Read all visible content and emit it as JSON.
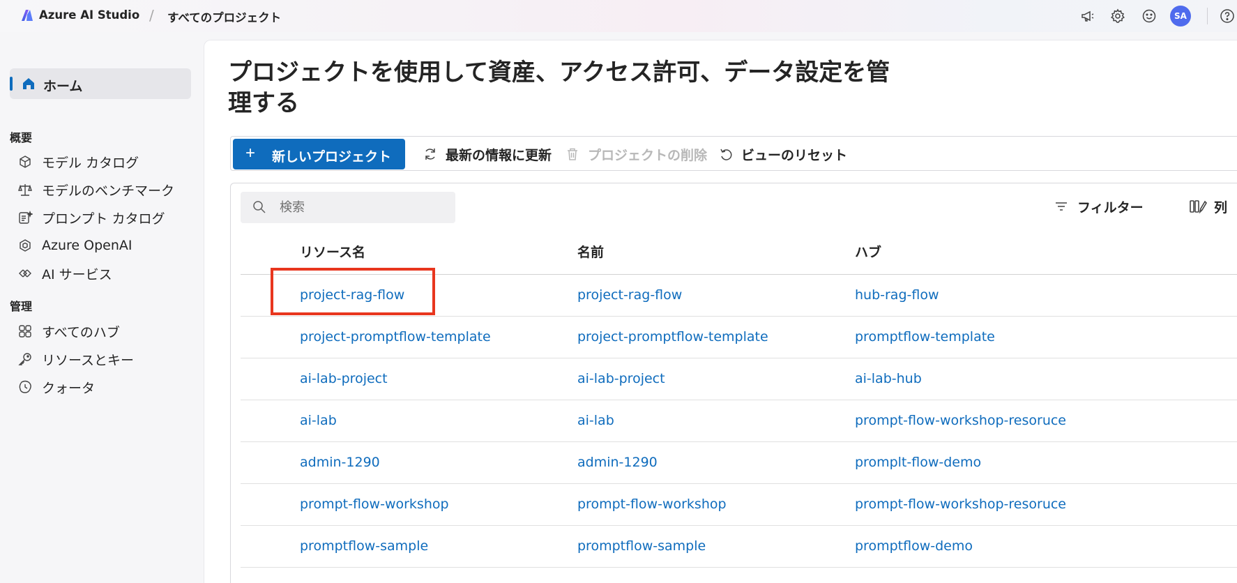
{
  "app": {
    "title": "Azure AI Studio",
    "breadcrumb_separator": "/",
    "breadcrumb": "すべてのプロジェクト",
    "avatar_initials": "SA",
    "brand_color": "#0f6cbd",
    "top_icons": [
      "announcement-icon",
      "settings-gear-icon",
      "feedback-smiley-icon",
      "help-icon"
    ]
  },
  "sidebar": {
    "home_label": "ホーム",
    "sections": [
      {
        "title": "概要",
        "items": [
          {
            "label": "モデル カタログ",
            "icon": "cube-icon"
          },
          {
            "label": "モデルのベンチマーク",
            "icon": "scale-icon"
          },
          {
            "label": "プロンプト カタログ",
            "icon": "prompt-icon"
          },
          {
            "label": "Azure OpenAI",
            "icon": "openai-icon"
          },
          {
            "label": "AI サービス",
            "icon": "ai-services-icon"
          }
        ]
      },
      {
        "title": "管理",
        "items": [
          {
            "label": "すべてのハブ",
            "icon": "grid-icon"
          },
          {
            "label": "リソースとキー",
            "icon": "key-icon"
          },
          {
            "label": "クォータ",
            "icon": "quota-icon"
          }
        ]
      }
    ]
  },
  "main": {
    "title": "プロジェクトを使用して資産、アクセス許可、データ設定を管理する",
    "toolbar": {
      "new_project": "新しいプロジェクト",
      "refresh": "最新の情報に更新",
      "delete_project": "プロジェクトの削除",
      "reset_view": "ビューのリセット"
    },
    "search": {
      "placeholder": "検索"
    },
    "filter_label": "フィルター",
    "columns_label": "列",
    "table": {
      "headers": [
        "リソース名",
        "名前",
        "ハブ"
      ],
      "rows": [
        [
          "project-rag-flow",
          "project-rag-flow",
          "hub-rag-flow"
        ],
        [
          "project-promptflow-template",
          "project-promptflow-template",
          "promptflow-template"
        ],
        [
          "ai-lab-project",
          "ai-lab-project",
          "ai-lab-hub"
        ],
        [
          "ai-lab",
          "ai-lab",
          "prompt-flow-workshop-resoruce"
        ],
        [
          "admin-1290",
          "admin-1290",
          "promplt-flow-demo"
        ],
        [
          "prompt-flow-workshop",
          "prompt-flow-workshop",
          "prompt-flow-workshop-resoruce"
        ],
        [
          "promptflow-sample",
          "promptflow-sample",
          "promptflow-demo"
        ]
      ]
    },
    "highlight_color": "#e8361e"
  }
}
